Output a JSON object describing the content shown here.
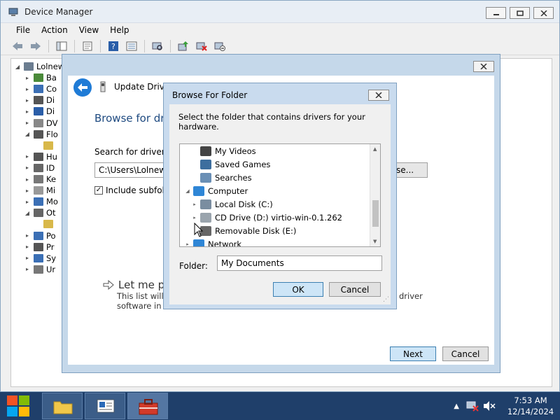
{
  "dm": {
    "title": "Device Manager",
    "menu": [
      "File",
      "Action",
      "View",
      "Help"
    ],
    "tree": [
      {
        "label": "Lolnew",
        "indent": 0,
        "arrow": "◢",
        "color": "#6b7d90"
      },
      {
        "label": "Ba",
        "indent": 1,
        "arrow": "▸",
        "color": "#4a8a3a"
      },
      {
        "label": "Co",
        "indent": 1,
        "arrow": "▸",
        "color": "#3b6fb5"
      },
      {
        "label": "Di",
        "indent": 1,
        "arrow": "▸",
        "color": "#555"
      },
      {
        "label": "Di",
        "indent": 1,
        "arrow": "▸",
        "color": "#2a5ea8"
      },
      {
        "label": "DV",
        "indent": 1,
        "arrow": "▸",
        "color": "#888"
      },
      {
        "label": "Flo",
        "indent": 1,
        "arrow": "◢",
        "color": "#555"
      },
      {
        "label": "",
        "indent": 2,
        "arrow": "",
        "color": "#d8b84a"
      },
      {
        "label": "Hu",
        "indent": 1,
        "arrow": "▸",
        "color": "#555"
      },
      {
        "label": "ID",
        "indent": 1,
        "arrow": "▸",
        "color": "#666"
      },
      {
        "label": "Ke",
        "indent": 1,
        "arrow": "▸",
        "color": "#777"
      },
      {
        "label": "Mi",
        "indent": 1,
        "arrow": "▸",
        "color": "#999"
      },
      {
        "label": "Mo",
        "indent": 1,
        "arrow": "▸",
        "color": "#3b6fb5"
      },
      {
        "label": "Ot",
        "indent": 1,
        "arrow": "◢",
        "color": "#666"
      },
      {
        "label": "",
        "indent": 2,
        "arrow": "",
        "color": "#d8b84a"
      },
      {
        "label": "Po",
        "indent": 1,
        "arrow": "▸",
        "color": "#3b6fb5"
      },
      {
        "label": "Pr",
        "indent": 1,
        "arrow": "▸",
        "color": "#555"
      },
      {
        "label": "Sy",
        "indent": 1,
        "arrow": "▸",
        "color": "#3b6fb5"
      },
      {
        "label": "Ur",
        "indent": 1,
        "arrow": "▸",
        "color": "#777"
      }
    ]
  },
  "update_driver": {
    "title": "Update Driver S",
    "heading": "Browse for driv",
    "search_label": "Search for driver so",
    "path_value": "C:\\Users\\Lolnewp",
    "browse_label": "se...",
    "include_subfolders": "Include subfold",
    "let_me_pick": "Let me pic",
    "let_me_desc_1": "This list will s",
    "let_me_desc_2": "software in t",
    "let_me_desc_right": "driver",
    "next_label": "Next",
    "cancel_label": "Cancel"
  },
  "browse_folder": {
    "title": "Browse For Folder",
    "prompt": "Select the folder that contains drivers for your hardware.",
    "tree": [
      {
        "label": "My Videos",
        "indent": 1,
        "arrow": "",
        "icon": "video-folder-icon",
        "color": "#444"
      },
      {
        "label": "Saved Games",
        "indent": 1,
        "arrow": "",
        "icon": "saved-games-icon",
        "color": "#3d6e9e"
      },
      {
        "label": "Searches",
        "indent": 1,
        "arrow": "",
        "icon": "search-icon",
        "color": "#6a8fb5"
      },
      {
        "label": "Computer",
        "indent": 0,
        "arrow": "◢",
        "icon": "computer-icon",
        "color": "#2f86d6"
      },
      {
        "label": "Local Disk (C:)",
        "indent": 1,
        "arrow": "▸",
        "icon": "drive-icon",
        "color": "#7a8da0"
      },
      {
        "label": "CD Drive (D:) virtio-win-0.1.262",
        "indent": 1,
        "arrow": "▸",
        "icon": "cd-drive-icon",
        "color": "#9aa4ad"
      },
      {
        "label": "Removable Disk (E:)",
        "indent": 1,
        "arrow": "",
        "icon": "removable-disk-icon",
        "color": "#666"
      },
      {
        "label": "Network",
        "indent": 0,
        "arrow": "▸",
        "icon": "network-icon",
        "color": "#2f86d6"
      }
    ],
    "folder_label": "Folder:",
    "folder_value": "My Documents",
    "ok_label": "OK",
    "cancel_label": "Cancel"
  },
  "taskbar": {
    "time": "7:53 AM",
    "date": "12/14/2024"
  }
}
